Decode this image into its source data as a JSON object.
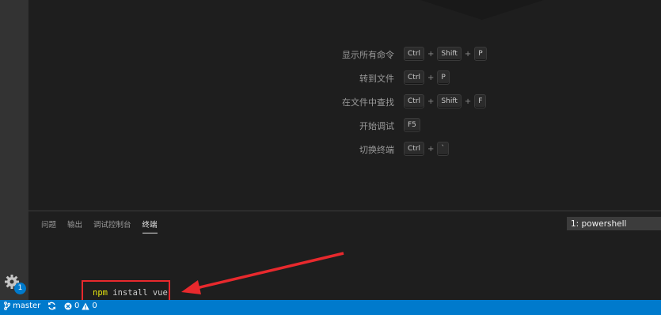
{
  "shortcuts": [
    {
      "label": "显示所有命令",
      "keys": [
        "Ctrl",
        "Shift",
        "P"
      ]
    },
    {
      "label": "转到文件",
      "keys": [
        "Ctrl",
        "P"
      ]
    },
    {
      "label": "在文件中查找",
      "keys": [
        "Ctrl",
        "Shift",
        "F"
      ]
    },
    {
      "label": "开始调试",
      "keys": [
        "F5"
      ]
    },
    {
      "label": "切换终端",
      "keys": [
        "Ctrl",
        "`"
      ]
    }
  ],
  "plus_sign": "+",
  "panel": {
    "tabs": [
      "问题",
      "输出",
      "调试控制台",
      "终端"
    ],
    "active_tab": 3,
    "terminal_selector": "1: powershell",
    "command_program": "npm",
    "command_args": " install vue"
  },
  "activity": {
    "gear_badge": "1"
  },
  "statusbar": {
    "branch": "master",
    "errors": "0",
    "warnings": "0"
  },
  "colors": {
    "statusbar": "#007acc",
    "highlight": "#e8292d",
    "npm": "#e5e510"
  }
}
